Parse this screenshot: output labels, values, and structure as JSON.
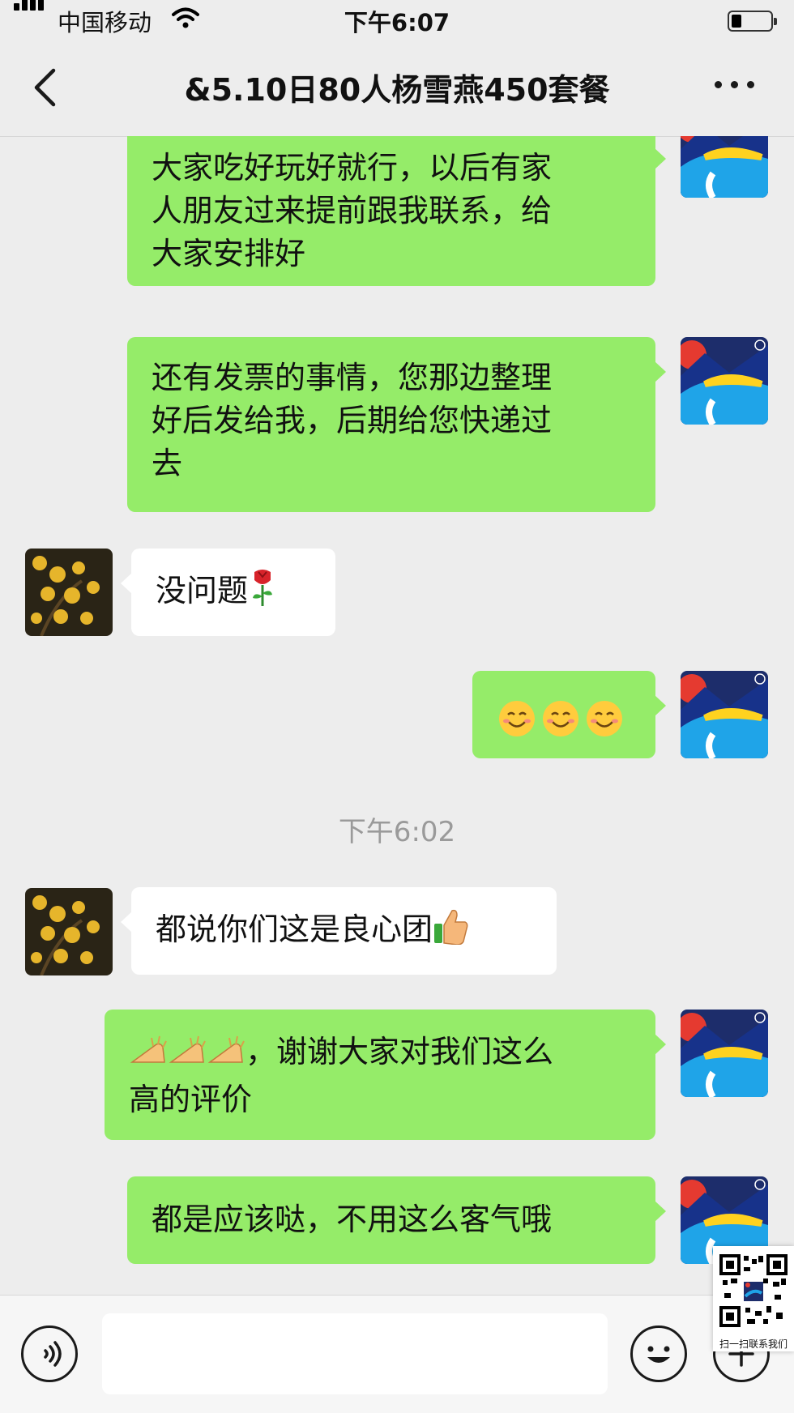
{
  "status_bar": {
    "carrier": "中国移动",
    "time": "下午6:07"
  },
  "nav": {
    "title": "&5.10日80人杨雪燕450套餐"
  },
  "messages": [
    {
      "side": "me",
      "lines": [
        "大家吃好玩好就行，以后有家",
        "人朋友过来提前跟我联系，给",
        "大家安排好"
      ]
    },
    {
      "side": "me",
      "lines": [
        "还有发票的事情，您那边整理",
        "好后发给我，后期给您快递过",
        "去"
      ]
    },
    {
      "side": "them",
      "text": "没问题",
      "emoji": "rose-icon"
    },
    {
      "side": "me",
      "emoji": "smile-icon",
      "count": 3
    },
    {
      "side": "them",
      "text": "都说你们这是良心团",
      "emoji": "thumbs-up-icon"
    },
    {
      "side": "me",
      "prefix_emoji": "clapping-hands-icon",
      "lines": [
        "，谢谢大家对我们这么",
        "高的评价"
      ]
    },
    {
      "side": "me",
      "lines": [
        "都是应该哒，不用这么客气哦"
      ]
    }
  ],
  "timestamp": "下午6:02",
  "input": {
    "value": "",
    "placeholder": ""
  },
  "qr_overlay": {
    "caption": "扫一扫联系我们"
  },
  "colors": {
    "my_bubble": "#95ec69",
    "their_bubble": "#ffffff",
    "background": "#ededed"
  }
}
